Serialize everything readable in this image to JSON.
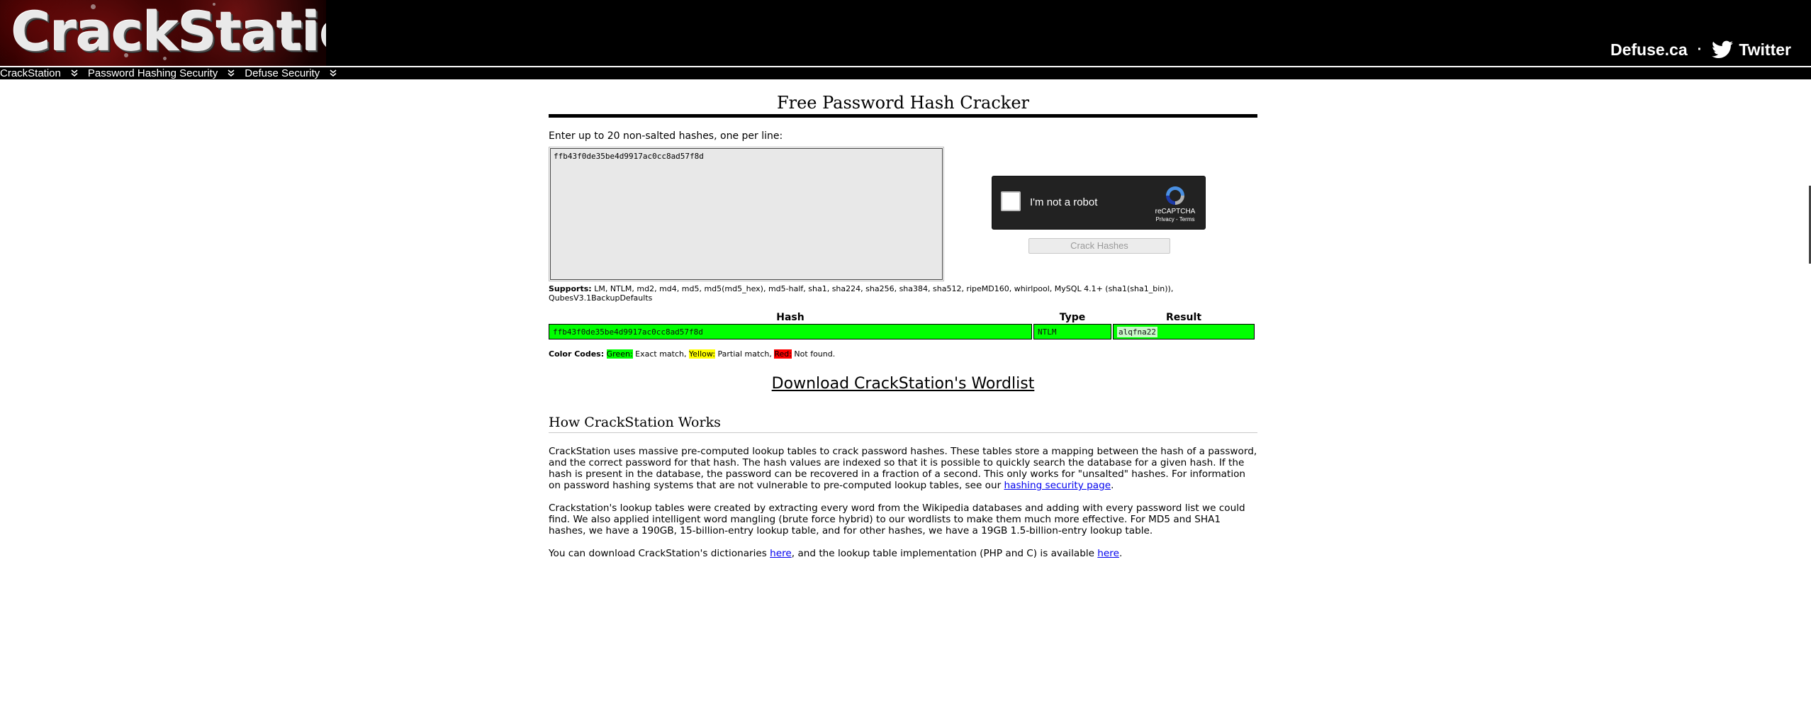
{
  "header": {
    "logo_text": "CrackStation",
    "links": {
      "defuse": "Defuse.ca",
      "separator": "·",
      "twitter": "Twitter"
    }
  },
  "nav": {
    "items": [
      {
        "label": "CrackStation",
        "chevron": "»"
      },
      {
        "label": "Password Hashing Security",
        "chevron": "»"
      },
      {
        "label": "Defuse Security",
        "chevron": "»"
      }
    ]
  },
  "main": {
    "title": "Free Password Hash Cracker",
    "instructions": "Enter up to 20 non-salted hashes, one per line:",
    "hash_input_value": "ffb43f0de35be4d9917ac0cc8ad57f8d",
    "captcha": {
      "label": "I'm not a robot",
      "brand": "reCAPTCHA",
      "links": "Privacy - Terms"
    },
    "crack_button": "Crack Hashes",
    "supports_label": "Supports:",
    "supports_text": "LM, NTLM, md2, md4, md5, md5(md5_hex), md5-half, sha1, sha224, sha256, sha384, sha512, ripeMD160, whirlpool, MySQL 4.1+ (sha1(sha1_bin)), QubesV3.1BackupDefaults",
    "results": {
      "headers": {
        "hash": "Hash",
        "type": "Type",
        "result": "Result"
      },
      "rows": [
        {
          "hash": "ffb43f0de35be4d9917ac0cc8ad57f8d",
          "type": "NTLM",
          "result": "alqfna22"
        }
      ]
    },
    "color_codes": {
      "label": "Color Codes:",
      "green": "Green:",
      "green_desc": " Exact match, ",
      "yellow": "Yellow:",
      "yellow_desc": " Partial match, ",
      "red": "Red:",
      "red_desc": " Not found."
    },
    "download_link": "Download CrackStation's Wordlist",
    "how_title": "How CrackStation Works",
    "para1_text": "CrackStation uses massive pre-computed lookup tables to crack password hashes. These tables store a mapping between the hash of a password, and the correct password for that hash. The hash values are indexed so that it is possible to quickly search the database for a given hash. If the hash is present in the database, the password can be recovered in a fraction of a second. This only works for \"unsalted\" hashes. For information on password hashing systems that are not vulnerable to pre-computed lookup tables, see our ",
    "para1_link": "hashing security page",
    "para1_end": ".",
    "para2_text": "Crackstation's lookup tables were created by extracting every word from the Wikipedia databases and adding with every password list we could find. We also applied intelligent word mangling (brute force hybrid) to our wordlists to make them much more effective. For MD5 and SHA1 hashes, we have a 190GB, 15-billion-entry lookup table, and for other hashes, we have a 19GB 1.5-billion-entry lookup table.",
    "para3_a": "You can download CrackStation's dictionaries ",
    "para3_link1": "here",
    "para3_b": ", and the lookup table implementation (PHP and C) is available ",
    "para3_link2": "here",
    "para3_c": "."
  },
  "colors": {
    "match_green": "#00ff00",
    "partial_yellow": "#ffff00",
    "notfound_red": "#ff0000",
    "link_blue": "#0000ee"
  }
}
